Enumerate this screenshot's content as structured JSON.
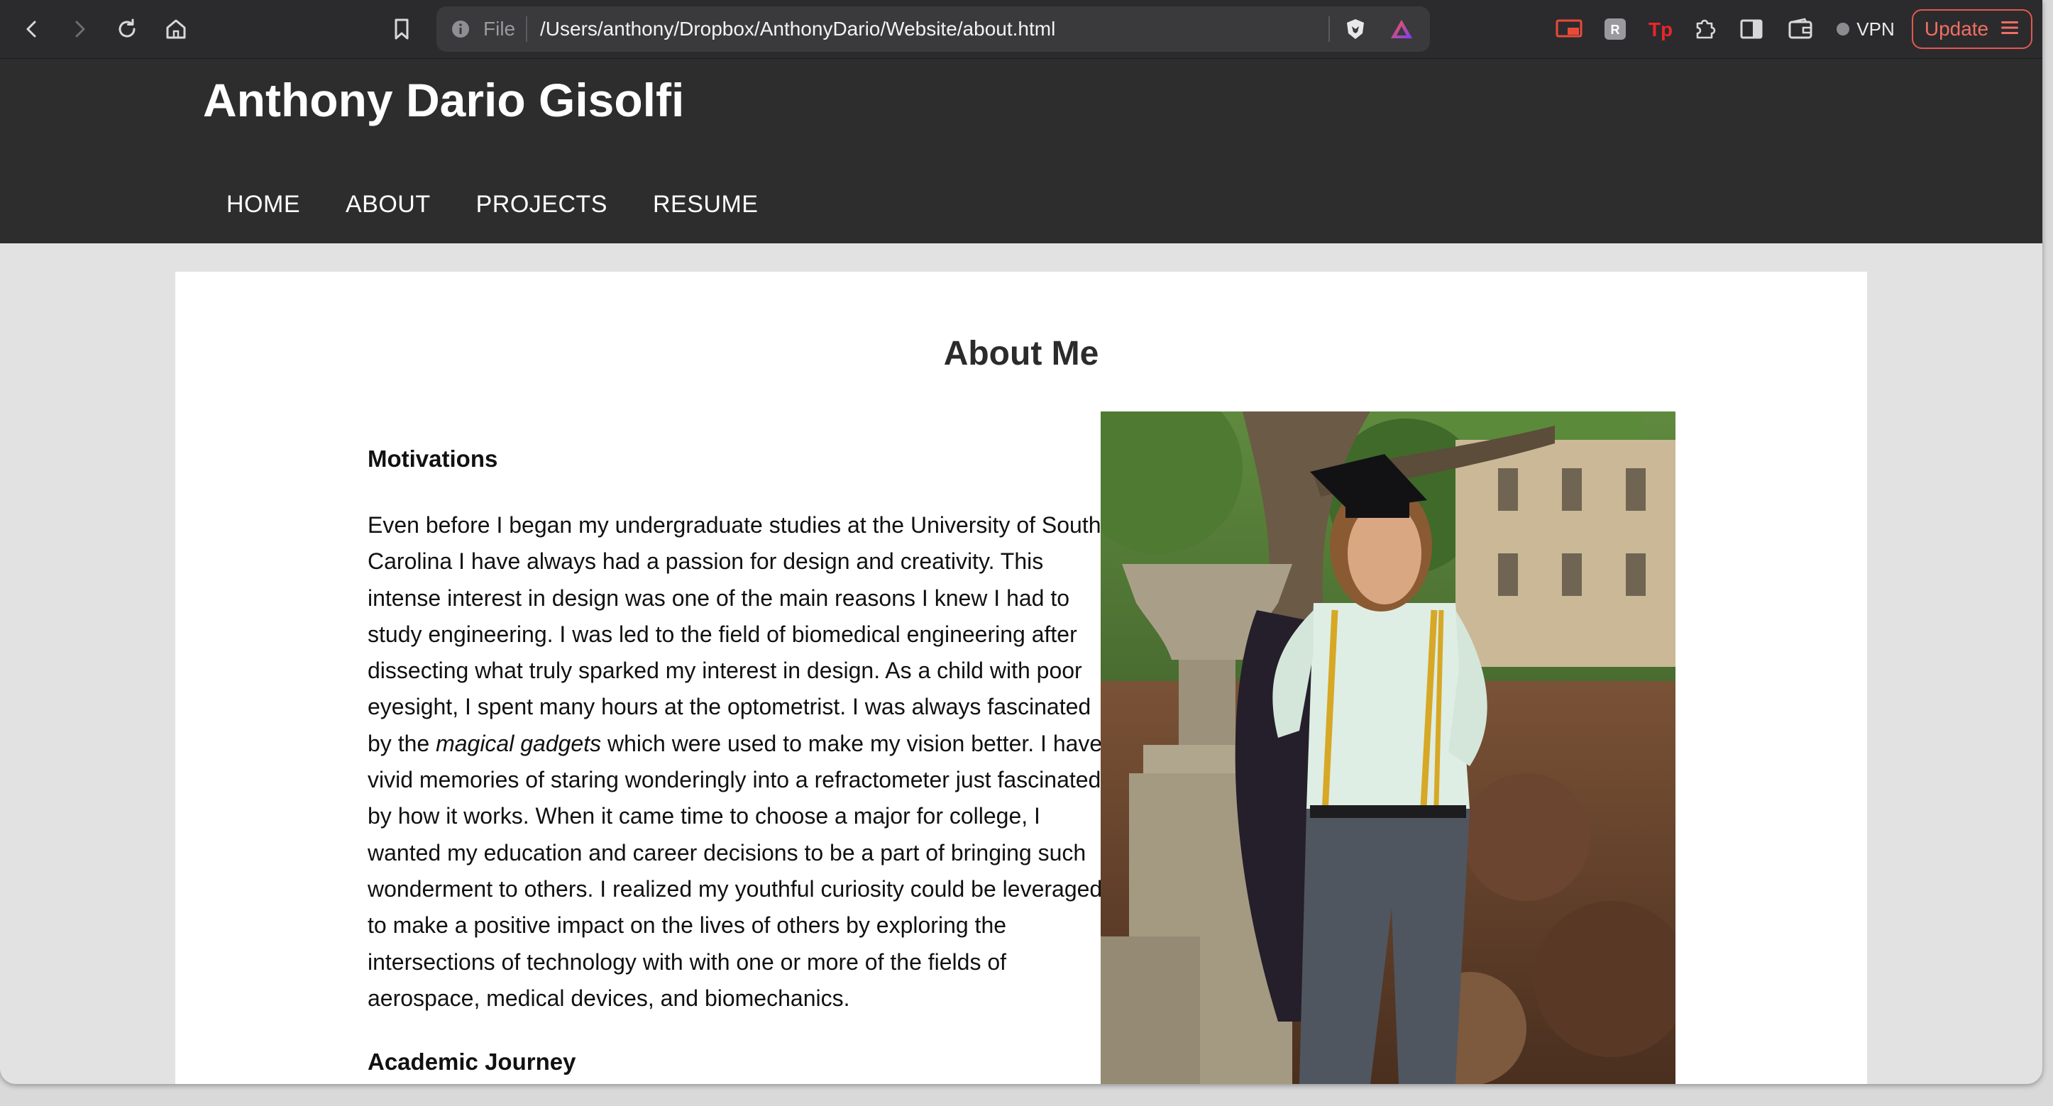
{
  "browser": {
    "scheme_label": "File",
    "url": "/Users/anthony/Dropbox/AnthonyDario/Website/about.html",
    "vpn_label": "VPN",
    "update_label": "Update",
    "icons": {
      "back": "chevron-left-icon",
      "forward": "chevron-right-icon",
      "reload": "reload-icon",
      "home": "home-icon",
      "bookmark": "bookmark-icon",
      "info": "info-icon",
      "brave_shields": "lion-shield-icon",
      "brave_rewards": "triangle-rewards-icon",
      "cast": "cast-icon",
      "extension_1": "extension-icon",
      "extension_tp": "tp-extension-icon",
      "extensions": "puzzle-icon",
      "sidebar": "sidebar-icon",
      "wallet": "wallet-icon",
      "menu": "hamburger-menu-icon"
    },
    "colors": {
      "toolbar_bg": "#2b2b2d",
      "accent_update": "#e4574f"
    }
  },
  "site": {
    "title": "Anthony Dario Gisolfi",
    "nav": [
      {
        "label": "HOME"
      },
      {
        "label": "ABOUT"
      },
      {
        "label": "PROJECTS"
      },
      {
        "label": "RESUME"
      }
    ],
    "colors": {
      "header_bg": "#2d2d2d",
      "page_bg": "#e2e2e2",
      "card_bg": "#ffffff"
    }
  },
  "about": {
    "heading": "About Me",
    "motivations_heading": "Motivations",
    "motivations_text_before": "Even before I began my undergraduate studies at the University of South Carolina I have always had a passion for design and creativity. This intense interest in design was one of the main reasons I knew I had to study engineering. I was led to the field of biomedical engineering after dissecting what truly sparked my interest in design. As a child with poor eyesight, I spent many hours at the optometrist. I was always fascinated by the ",
    "motivations_text_em": "magical gadgets",
    "motivations_text_after": " which were used to make my vision better. I have vivid memories of staring wonderingly into a refractometer just fascinated by how it works. When it came time to choose a major for college, I wanted my education and career decisions to be a part of bringing such wonderment to others. I realized my youthful curiosity could be leveraged to make a positive impact on the lives of others by exploring the intersections of technology with with one or more of the fields of aerospace, medical devices, and biomechanics.",
    "academic_heading": "Academic Journey",
    "photo": "graduation-portrait-photo"
  }
}
